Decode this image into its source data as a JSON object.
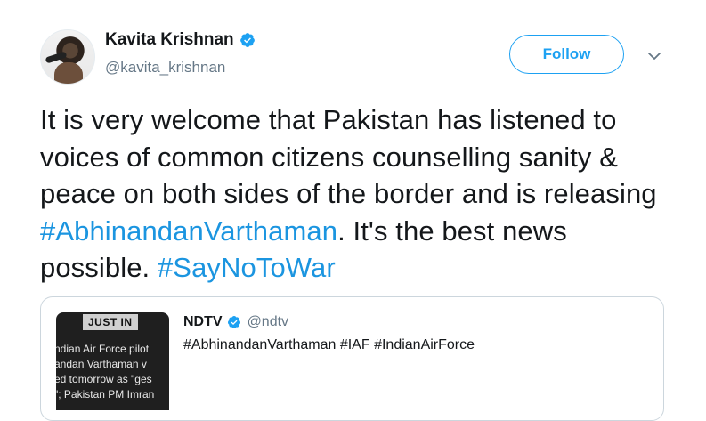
{
  "author": {
    "display_name": "Kavita Krishnan",
    "handle": "@kavita_krishnan",
    "verified": true
  },
  "actions": {
    "follow_label": "Follow",
    "more_icon": "chevron-down-icon"
  },
  "tweet": {
    "segments": [
      {
        "text": "It is very welcome that Pakistan has listened to voices of common citizens counselling sanity & peace on both sides of the border and is releasing ",
        "type": "text"
      },
      {
        "text": "#AbhinandanVarthaman",
        "type": "hashtag"
      },
      {
        "text": ". It's the best news possible. ",
        "type": "text"
      },
      {
        "text": "#SayNoToWar",
        "type": "hashtag"
      }
    ]
  },
  "quoted_tweet": {
    "display_name": "NDTV",
    "handle": "@ndtv",
    "verified": true,
    "text": "#AbhinandanVarthaman #IAF #IndianAirForce",
    "thumbnail": {
      "badge": "JUST IN",
      "lines": [
        "ndian Air Force pilot",
        "andan Varthaman v",
        "ed tomorrow as \"ges",
        "\"; Pakistan PM Imran"
      ]
    }
  },
  "colors": {
    "accent": "#1da1f2",
    "hashtag": "#1b95e0",
    "secondary_text": "#657786",
    "border": "#ccd6dd"
  }
}
